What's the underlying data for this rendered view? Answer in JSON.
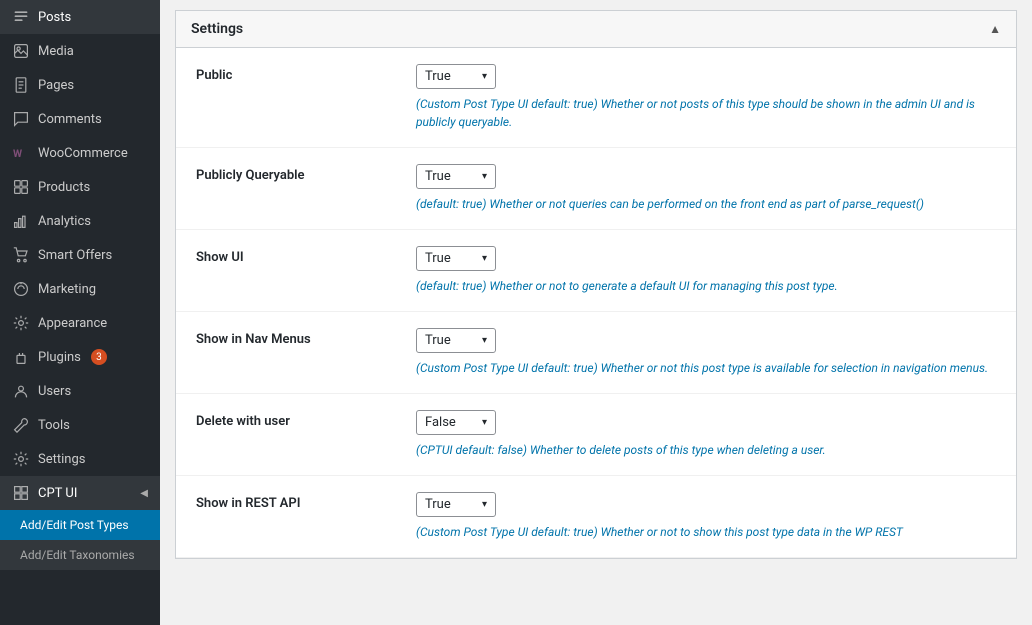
{
  "sidebar": {
    "items": [
      {
        "id": "posts",
        "label": "Posts",
        "icon": "✎",
        "active": false
      },
      {
        "id": "media",
        "label": "Media",
        "icon": "🖼",
        "active": false
      },
      {
        "id": "pages",
        "label": "Pages",
        "icon": "📄",
        "active": false
      },
      {
        "id": "comments",
        "label": "Comments",
        "icon": "💬",
        "active": false
      },
      {
        "id": "woocommerce",
        "label": "WooCommerce",
        "icon": "W",
        "active": false
      },
      {
        "id": "products",
        "label": "Products",
        "icon": "🏪",
        "active": false
      },
      {
        "id": "analytics",
        "label": "Analytics",
        "icon": "📊",
        "active": false
      },
      {
        "id": "smart-offers",
        "label": "Smart Offers",
        "icon": "🛒",
        "active": false
      },
      {
        "id": "marketing",
        "label": "Marketing",
        "icon": "📣",
        "active": false
      },
      {
        "id": "appearance",
        "label": "Appearance",
        "icon": "🎨",
        "active": false
      },
      {
        "id": "plugins",
        "label": "Plugins",
        "icon": "🔌",
        "active": false,
        "badge": "3"
      },
      {
        "id": "users",
        "label": "Users",
        "icon": "👤",
        "active": false
      },
      {
        "id": "tools",
        "label": "Tools",
        "icon": "🔧",
        "active": false
      },
      {
        "id": "settings",
        "label": "Settings",
        "icon": "⚙",
        "active": false
      },
      {
        "id": "cpt-ui",
        "label": "CPT UI",
        "icon": "⊞",
        "active": true
      }
    ],
    "sub_items": [
      {
        "id": "add-edit-post-types",
        "label": "Add/Edit Post Types",
        "active": true
      },
      {
        "id": "add-edit-taxonomies",
        "label": "Add/Edit Taxonomies",
        "active": false
      }
    ]
  },
  "settings_panel": {
    "title": "Settings",
    "rows": [
      {
        "id": "public",
        "label": "Public",
        "select_value": "True",
        "description": "(Custom Post Type UI default: true) Whether or not posts of this type should be shown in the admin UI and is publicly queryable."
      },
      {
        "id": "publicly-queryable",
        "label": "Publicly Queryable",
        "select_value": "True",
        "description": "(default: true) Whether or not queries can be performed on the front end as part of parse_request()"
      },
      {
        "id": "show-ui",
        "label": "Show UI",
        "select_value": "True",
        "description": "(default: true) Whether or not to generate a default UI for managing this post type."
      },
      {
        "id": "show-in-nav-menus",
        "label": "Show in Nav Menus",
        "select_value": "True",
        "description": "(Custom Post Type UI default: true) Whether or not this post type is available for selection in navigation menus."
      },
      {
        "id": "delete-with-user",
        "label": "Delete with user",
        "select_value": "False",
        "description": "(CPTUI default: false) Whether to delete posts of this type when deleting a user."
      },
      {
        "id": "show-in-rest-api",
        "label": "Show in REST API",
        "select_value": "True",
        "description": "(Custom Post Type UI default: true) Whether or not to show this post type data in the WP REST"
      }
    ]
  }
}
